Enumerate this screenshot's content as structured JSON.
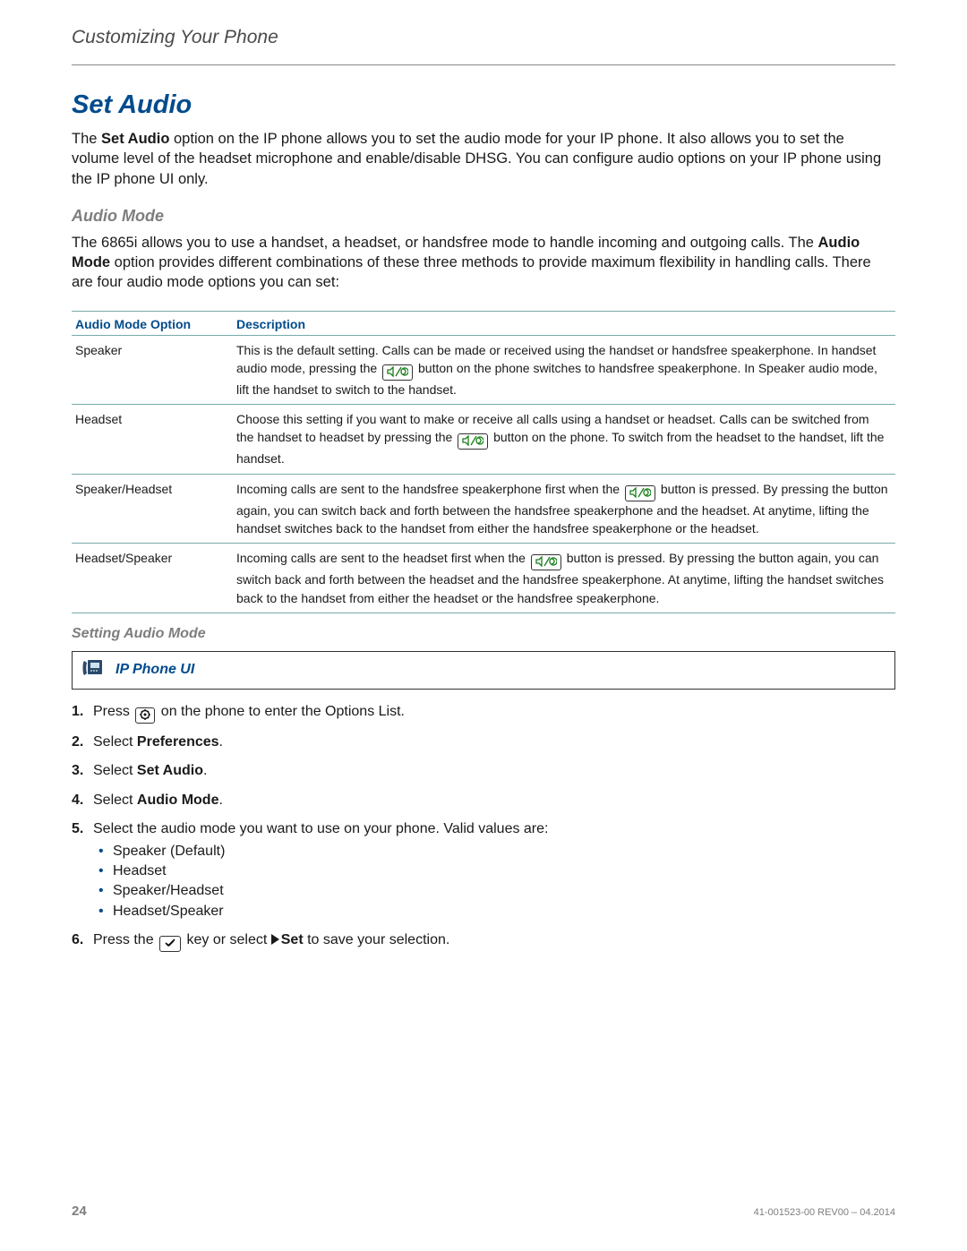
{
  "chapter": "Customizing Your Phone",
  "section_title": "Set Audio",
  "intro": {
    "p1_a": "The ",
    "p1_bold": "Set Audio",
    "p1_b": " option on the IP phone allows you to set the audio mode for your IP phone. It also allows you to set the volume level of the headset microphone and enable/disable DHSG. You can configure audio options on your IP phone using the IP phone UI only."
  },
  "audio_mode": {
    "heading": "Audio Mode",
    "p_a": "The 6865i allows you to use a handset, a headset, or handsfree mode to handle incoming and outgoing calls. The ",
    "p_bold": "Audio Mode",
    "p_b": " option provides different combinations of these three methods to provide maximum flexibility in handling calls. There are four audio mode options you can set:",
    "th_option": "Audio Mode Option",
    "th_desc": "Description",
    "rows": [
      {
        "option": "Speaker",
        "d1": "This is the default setting. Calls can be made or received using the handset or handsfree speakerphone. In handset audio mode, pressing the ",
        "d2": " button on the phone switches to handsfree speakerphone. In Speaker audio mode, lift the handset to switch to the handset."
      },
      {
        "option": "Headset",
        "d1": "Choose this setting if you want to make or receive all calls using a handset or headset. Calls can be switched from the handset to headset by pressing the ",
        "d2": " button on the phone. To switch from the headset to the handset, lift the handset."
      },
      {
        "option": "Speaker/Headset",
        "d1": "Incoming calls are sent to the handsfree speakerphone first when the ",
        "d2": " button is pressed. By pressing the button again, you can switch back and forth between the handsfree speakerphone and the headset. At anytime, lifting the handset switches back to the handset from either the handsfree speakerphone or the headset."
      },
      {
        "option": "Headset/Speaker",
        "d1": "Incoming calls are sent to the headset first when the ",
        "d2": " button is pressed. By pressing the button again, you can switch back and forth between the headset and the handsfree speakerphone. At anytime, lifting the handset switches back to the handset from either the headset or the handsfree speakerphone."
      }
    ]
  },
  "setting": {
    "heading": "Setting Audio Mode",
    "ui_label": "IP Phone UI",
    "steps": {
      "s1a": "Press ",
      "s1b": " on the phone to enter the Options List.",
      "s2a": "Select ",
      "s2b": "Preferences",
      "s2c": ".",
      "s3a": "Select ",
      "s3b": "Set Audio",
      "s3c": ".",
      "s4a": "Select ",
      "s4b": "Audio Mode",
      "s4c": ".",
      "s5": "Select the audio mode you want to use on your phone. Valid values are:",
      "s5_opts": [
        "Speaker (Default)",
        "Headset",
        "Speaker/Headset",
        "Headset/Speaker"
      ],
      "s6a": "Press the ",
      "s6b": " key or select ",
      "s6c": "Set",
      "s6d": " to save your selection."
    }
  },
  "footer": {
    "page": "24",
    "rev": "41-001523-00 REV00 – 04.2014"
  }
}
